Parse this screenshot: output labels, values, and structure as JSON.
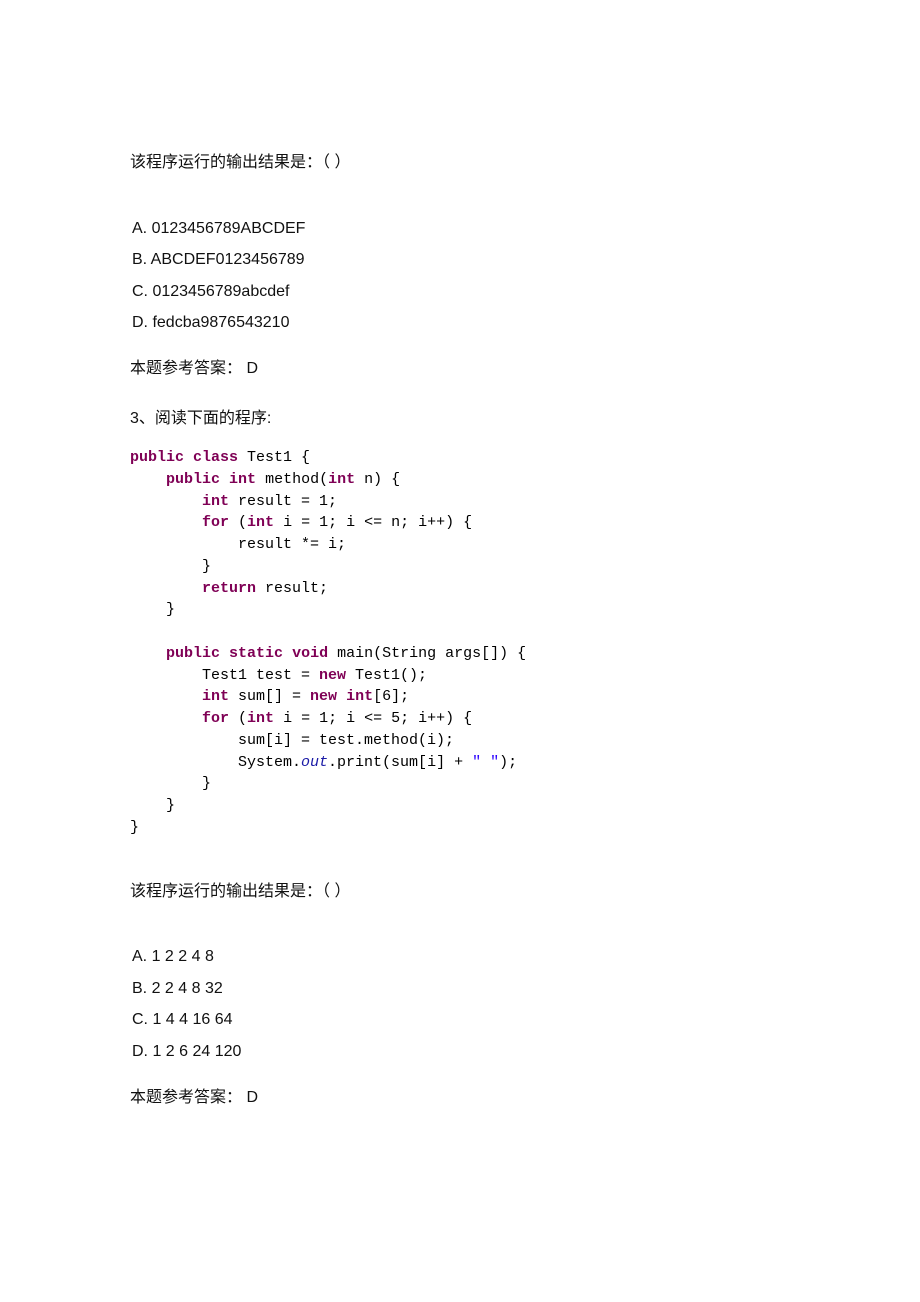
{
  "q2": {
    "stem": "该程序运行的输出结果是：（    ）",
    "options": {
      "a": "A. 0123456789ABCDEF",
      "b": "B. ABCDEF0123456789",
      "c": "C. 0123456789abcdef",
      "d": "D. fedcba9876543210"
    },
    "answer": "本题参考答案： D"
  },
  "q3": {
    "heading": "3、阅读下面的程序:",
    "code": {
      "l01a": "public",
      "l01b": " ",
      "l01c": "class",
      "l01d": " Test1 {",
      "l02a": "    ",
      "l02b": "public",
      "l02c": " ",
      "l02d": "int",
      "l02e": " method(",
      "l02f": "int",
      "l02g": " n) {",
      "l03a": "        ",
      "l03b": "int",
      "l03c": " result = 1;",
      "l04a": "        ",
      "l04b": "for",
      "l04c": " (",
      "l04d": "int",
      "l04e": " i = 1; i <= n; i++) {",
      "l05": "            result *= i;",
      "l06": "        }",
      "l07a": "        ",
      "l07b": "return",
      "l07c": " result;",
      "l08": "    }",
      "l09": "",
      "l10a": "    ",
      "l10b": "public",
      "l10c": " ",
      "l10d": "static",
      "l10e": " ",
      "l10f": "void",
      "l10g": " main(String args[]) {",
      "l11a": "        Test1 test = ",
      "l11b": "new",
      "l11c": " Test1();",
      "l12a": "        ",
      "l12b": "int",
      "l12c": " sum[] = ",
      "l12d": "new",
      "l12e": " ",
      "l12f": "int",
      "l12g": "[6];",
      "l13a": "        ",
      "l13b": "for",
      "l13c": " (",
      "l13d": "int",
      "l13e": " i = 1; i <= 5; i++) {",
      "l14": "            sum[i] = test.method(i);",
      "l15a": "            System.",
      "l15b": "out",
      "l15c": ".print(sum[i] + ",
      "l15d": "\" \"",
      "l15e": ");",
      "l16": "        }",
      "l17": "    }",
      "l18": "}"
    },
    "stem": "该程序运行的输出结果是：（    ）",
    "options": {
      "a": "A. 1 2 2 4 8",
      "b": "B. 2 2 4 8 32",
      "c": "C. 1 4 4 16 64",
      "d": "D. 1 2 6 24 120"
    },
    "answer": "本题参考答案： D"
  }
}
